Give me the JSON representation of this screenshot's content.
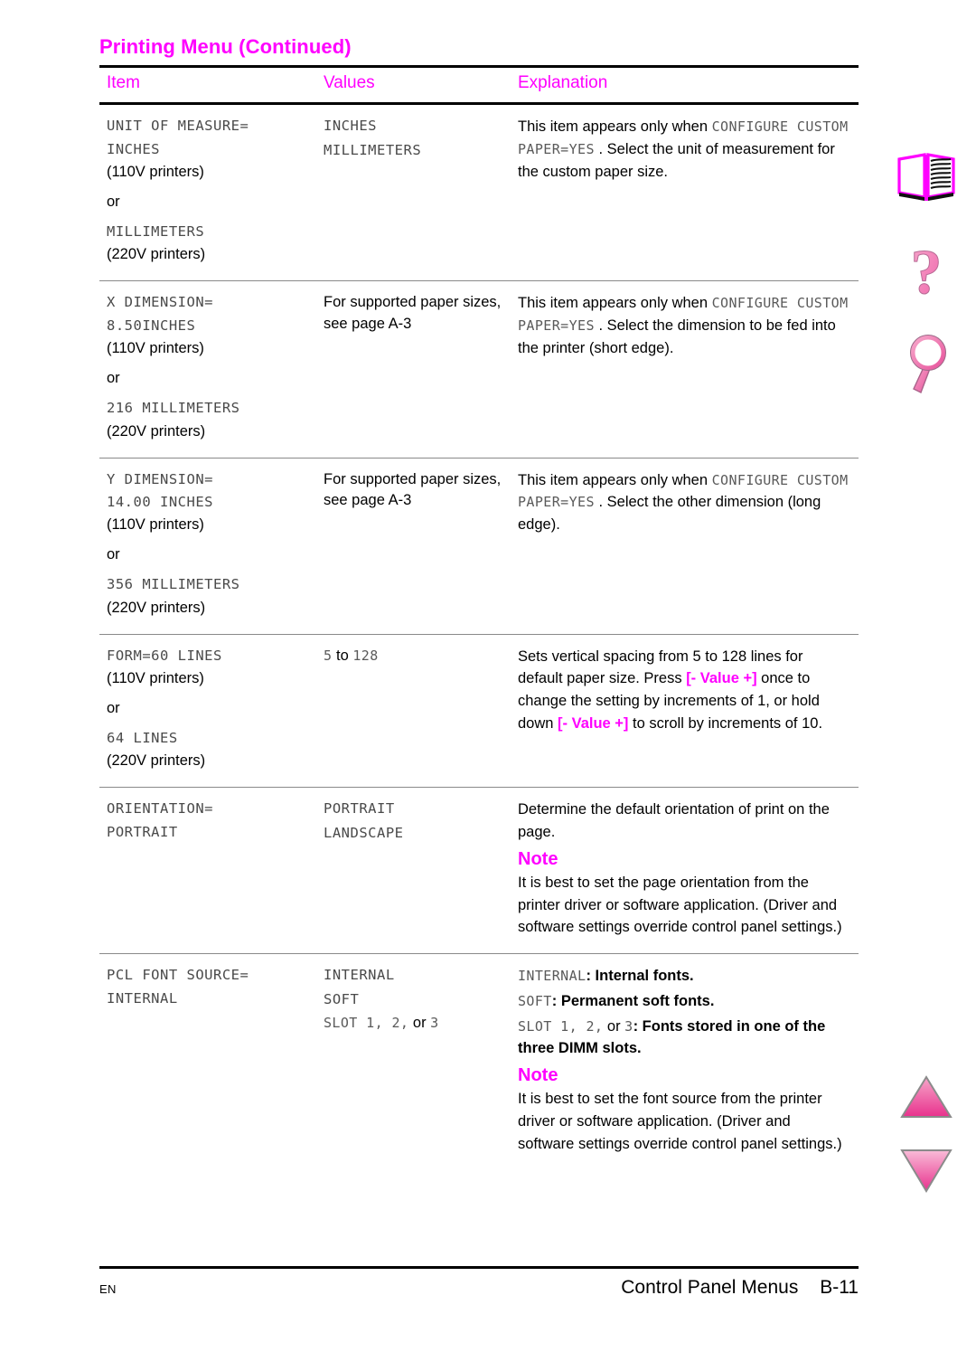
{
  "document": {
    "title": "Printing Menu (Continued)",
    "accent_color": "#FF00FF",
    "rule_color": "#000000"
  },
  "table": {
    "columns": [
      "Item",
      "Values",
      "Explanation"
    ],
    "rows": [
      {
        "item_lines": [
          {
            "text": "UNIT OF MEASURE=",
            "style": "lcd"
          },
          {
            "text": "INCHES",
            "style": "lcd"
          },
          {
            "text": "(110V printers)",
            "style": "plain"
          },
          {
            "text": "or",
            "style": "plain"
          },
          {
            "text": "MILLIMETERS",
            "style": "lcd"
          },
          {
            "text": "(220V printers)",
            "style": "plain"
          }
        ],
        "values_lines": [
          {
            "text": "INCHES",
            "style": "lcd"
          },
          {
            "text": "MILLIMETERS",
            "style": "lcd"
          }
        ],
        "explanation": [
          {
            "parts": [
              {
                "text": "This item appears only when ",
                "style": "plain"
              },
              {
                "text": "CONFIGURE CUSTOM PAPER=YES",
                "style": "lcd"
              },
              {
                "text": " . Select the unit of measurement for the custom paper size.",
                "style": "plain"
              }
            ]
          }
        ]
      },
      {
        "item_lines": [
          {
            "text": "X DIMENSION=",
            "style": "lcd"
          },
          {
            "text": "8.50INCHES",
            "style": "lcd"
          },
          {
            "text": "(110V printers)",
            "style": "plain"
          },
          {
            "text": "or",
            "style": "plain"
          },
          {
            "text": "216 MILLIMETERS",
            "style": "lcd"
          },
          {
            "text": "(220V printers)",
            "style": "plain"
          }
        ],
        "values_lines": [
          {
            "text": "For supported paper sizes, see page A-3",
            "style": "plain"
          }
        ],
        "explanation": [
          {
            "parts": [
              {
                "text": "This item appears only when ",
                "style": "plain"
              },
              {
                "text": "CONFIGURE CUSTOM PAPER=YES",
                "style": "lcd"
              },
              {
                "text": " . Select the dimension to be fed into the printer (short edge).",
                "style": "plain"
              }
            ]
          }
        ]
      },
      {
        "item_lines": [
          {
            "text": "Y DIMENSION=",
            "style": "lcd"
          },
          {
            "text": "14.00 INCHES",
            "style": "lcd"
          },
          {
            "text": "(110V printers)",
            "style": "plain"
          },
          {
            "text": "or",
            "style": "plain"
          },
          {
            "text": "356 MILLIMETERS",
            "style": "lcd"
          },
          {
            "text": "(220V printers)",
            "style": "plain"
          }
        ],
        "values_lines": [
          {
            "text": "For supported paper sizes, see page A-3",
            "style": "plain"
          }
        ],
        "explanation": [
          {
            "parts": [
              {
                "text": "This item appears only when ",
                "style": "plain"
              },
              {
                "text": "CONFIGURE CUSTOM PAPER=YES",
                "style": "lcd"
              },
              {
                "text": " . Select the other dimension (long edge).",
                "style": "plain"
              }
            ]
          }
        ]
      },
      {
        "item_lines": [
          {
            "text": "FORM=60 LINES",
            "style": "lcd"
          },
          {
            "text": "(110V printers)",
            "style": "plain"
          },
          {
            "text": "or",
            "style": "plain"
          },
          {
            "text": "64 LINES",
            "style": "lcd"
          },
          {
            "text": "(220V printers)",
            "style": "plain"
          }
        ],
        "values_lines": [
          {
            "text": "5 to 128",
            "style": "lcd-mixed"
          }
        ],
        "explanation": [
          {
            "parts": [
              {
                "text": "Sets vertical spacing from 5 to 128 lines for default paper size. Press ",
                "style": "plain"
              },
              {
                "text": "[- Value +]",
                "style": "key"
              },
              {
                "text": " once to change the setting by increments of 1, or hold down ",
                "style": "plain"
              },
              {
                "text": "[- Value +]",
                "style": "key"
              },
              {
                "text": " to scroll by increments of 10.",
                "style": "plain"
              }
            ]
          }
        ]
      },
      {
        "item_lines": [
          {
            "text": "ORIENTATION=",
            "style": "lcd"
          },
          {
            "text": "PORTRAIT",
            "style": "lcd"
          }
        ],
        "values_lines": [
          {
            "text": "PORTRAIT",
            "style": "lcd"
          },
          {
            "text": "LANDSCAPE",
            "style": "lcd"
          }
        ],
        "explanation": [
          {
            "parts": [
              {
                "text": "Determine the default orientation of print on the page.",
                "style": "plain"
              }
            ]
          },
          {
            "note_head": "Note"
          },
          {
            "parts": [
              {
                "text": "It is best to set the page orientation from the printer driver or software application. (Driver and software settings override control panel settings.)",
                "style": "plain"
              }
            ]
          }
        ]
      },
      {
        "item_lines": [
          {
            "text": "PCL FONT SOURCE=",
            "style": "lcd"
          },
          {
            "text": "INTERNAL",
            "style": "lcd"
          }
        ],
        "values_lines": [
          {
            "text": "INTERNAL",
            "style": "lcd"
          },
          {
            "text": "SOFT",
            "style": "lcd"
          },
          {
            "text": "SLOT 1, 2, or 3",
            "style": "lcd-mixed-slot"
          }
        ],
        "explanation": [
          {
            "parts": [
              {
                "text": "INTERNAL",
                "style": "lcd"
              },
              {
                "text": ": Internal fonts.",
                "style": "plain-bold-colon"
              }
            ]
          },
          {
            "parts": [
              {
                "text": "SOFT",
                "style": "lcd"
              },
              {
                "text": ": Permanent soft fonts.",
                "style": "plain-bold-colon"
              }
            ]
          },
          {
            "parts": [
              {
                "text": "SLOT 1, 2,",
                "style": "lcd"
              },
              {
                "text": " or ",
                "style": "plain"
              },
              {
                "text": "3",
                "style": "lcd"
              },
              {
                "text": ": Fonts stored in one of the three DIMM slots.",
                "style": "plain-bold-colon"
              }
            ]
          },
          {
            "note_head": "Note"
          },
          {
            "parts": [
              {
                "text": "It is best to set the font source from the printer driver or software application. (Driver and software settings override control panel settings.)",
                "style": "plain"
              }
            ]
          }
        ]
      }
    ]
  },
  "footer": {
    "language": "EN",
    "section": "Control Panel Menus",
    "page_number": "B-11"
  },
  "nav_icons": [
    {
      "name": "book-icon",
      "label": "open-book"
    },
    {
      "name": "question-mark-icon",
      "label": "help"
    },
    {
      "name": "magnifier-icon",
      "label": "search"
    },
    {
      "name": "arrow-up-icon",
      "label": "previous-page"
    },
    {
      "name": "arrow-down-icon",
      "label": "next-page"
    }
  ]
}
